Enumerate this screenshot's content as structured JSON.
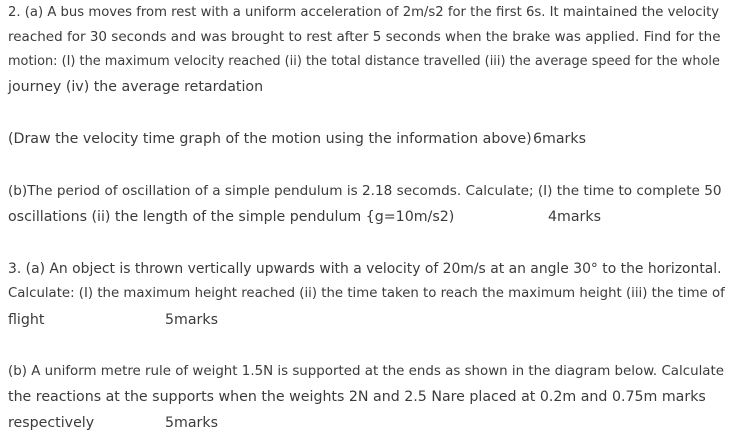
{
  "q2a": {
    "line1": "2. (a) A bus moves from rest with a uniform acceleration of 2m/s2 for the first 6s. It maintained the velocity",
    "line2": "reached for 30 seconds and was brought to rest after 5 seconds when the brake was applied. Find for the",
    "line3": "motion: (I) the maximum velocity reached (ii) the total distance travelled (iii) the average speed for the whole",
    "line4": "journey (iv) the average retardation"
  },
  "q2graph": {
    "text": "(Draw the velocity time graph of the motion using the information above)",
    "marks": "6marks"
  },
  "q2b": {
    "line1": "(b)The period of oscillation of a simple pendulum is 2.18 secomds. Calculate; (I) the time to complete 50",
    "line2": "oscillations (ii) the length of the simple pendulum {g=10m/s2)",
    "marks": "4marks"
  },
  "q3a": {
    "line1": "3. (a) An object is thrown vertically upwards with a velocity of 20m/s at an angle 30° to the horizontal.",
    "line2": "Calculate: (I) the maximum height reached (ii) the time taken to reach the maximum height (iii) the time of",
    "line3": "flight",
    "marks": "5marks"
  },
  "q3b": {
    "line1": "(b) A uniform metre rule of weight 1.5N is supported at the ends as shown in the diagram below. Calculate",
    "line2": "the reactions at the supports when the weights 2N and 2.5 Nare placed at 0.2m and 0.75m marks",
    "line3": "respectively",
    "marks": "5marks"
  }
}
